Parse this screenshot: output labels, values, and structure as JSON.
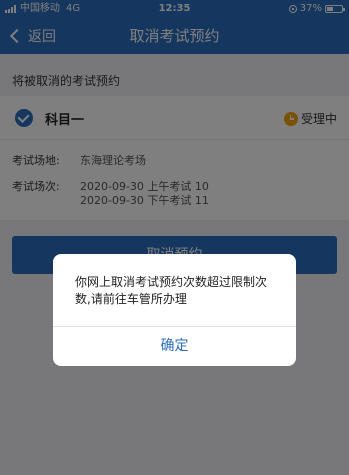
{
  "status_bar": {
    "carrier": "中国移动",
    "network": "4G",
    "time": "12:35",
    "battery": "37%"
  },
  "nav": {
    "back_label": "返回",
    "title": "取消考试预约"
  },
  "section": {
    "title": "将被取消的考试预约"
  },
  "appointment": {
    "subject": "科目一",
    "status": "受理中",
    "venue_label": "考试场地:",
    "venue": "东海理论考场",
    "session_label": "考试场次:",
    "sessions": [
      "2020-09-30 上午考试 10",
      "2020-09-30 下午考试 11"
    ]
  },
  "actions": {
    "cancel_label": "取消预约"
  },
  "dialog": {
    "message": "你网上取消考试预约次数超过限制次数,请前往车管所办理",
    "confirm_label": "确定"
  },
  "colors": {
    "brand": "#2a6dbd",
    "status_pending": "#f2a50f"
  }
}
